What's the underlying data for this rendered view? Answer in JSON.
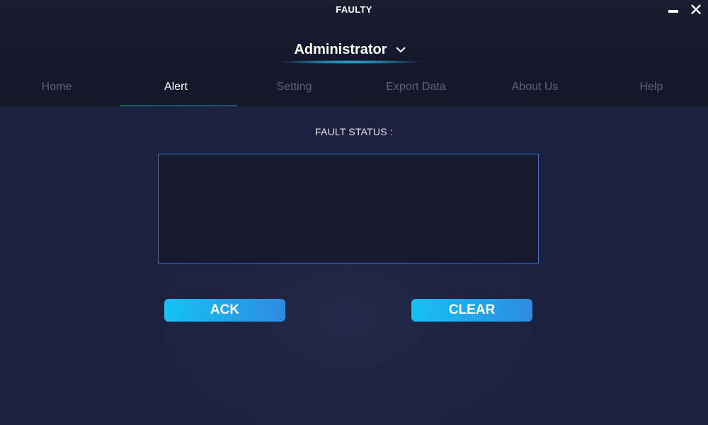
{
  "app": {
    "title": "FAULTY"
  },
  "user": {
    "name": "Administrator",
    "dropdown_icon": "chevron-down-icon"
  },
  "nav": {
    "tabs": [
      {
        "label": "Home",
        "active": false
      },
      {
        "label": "Alert",
        "active": true
      },
      {
        "label": "Setting",
        "active": false
      },
      {
        "label": "Export Data",
        "active": false
      },
      {
        "label": "About Us",
        "active": false
      },
      {
        "label": "Help",
        "active": false
      }
    ]
  },
  "alert": {
    "section_title": "FAULT STATUS :",
    "fault_status_value": "",
    "ack_label": "ACK",
    "clear_label": "CLEAR"
  },
  "colors": {
    "accent": "#14c2f3",
    "accent_end": "#2f8be0",
    "tab_indicator_start": "#1fb8a3",
    "background": "#1c2140",
    "header": "#15182a",
    "inactive_tab_text": "#5d6379"
  }
}
